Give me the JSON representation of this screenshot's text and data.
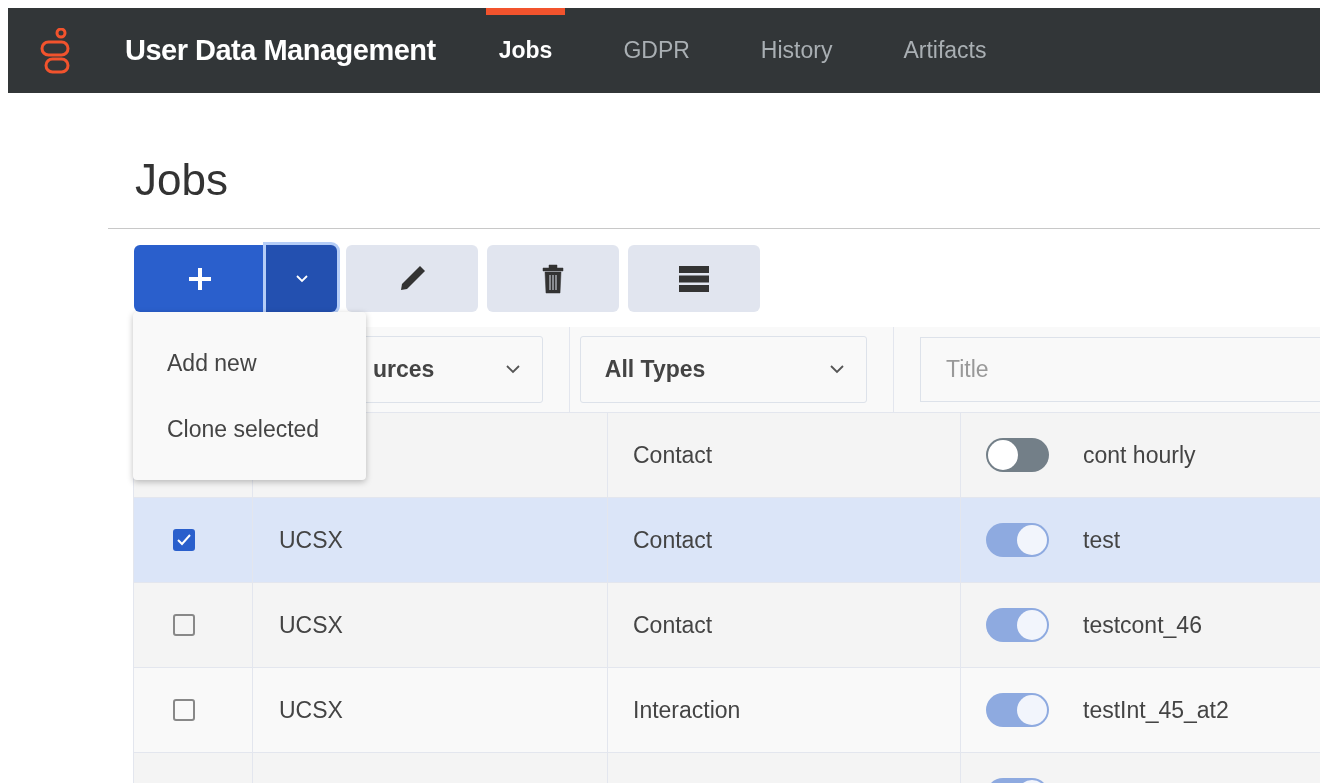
{
  "header": {
    "title": "User Data Management",
    "nav": [
      {
        "label": "Jobs",
        "selected": true
      },
      {
        "label": "GDPR",
        "selected": false
      },
      {
        "label": "History",
        "selected": false
      },
      {
        "label": "Artifacts",
        "selected": false
      }
    ]
  },
  "page_title": "Jobs",
  "add_menu": {
    "expanded": true,
    "items": [
      "Add new",
      "Clone selected"
    ]
  },
  "filters": {
    "source": "urces",
    "type": "All Types",
    "title_placeholder": "Title"
  },
  "rows": [
    {
      "type": "Contact",
      "on": false,
      "title": "cont hourly",
      "selected": false
    },
    {
      "checked": true,
      "source": "UCSX",
      "type": "Contact",
      "on": true,
      "title": "test",
      "selected": true
    },
    {
      "checked": false,
      "source": "UCSX",
      "type": "Contact",
      "on": true,
      "title": "testcont_46",
      "selected": false
    },
    {
      "checked": false,
      "source": "UCSX",
      "type": "Interaction",
      "on": true,
      "title": "testInt_45_at2",
      "selected": false
    },
    {
      "on": true,
      "selected": false
    }
  ]
}
